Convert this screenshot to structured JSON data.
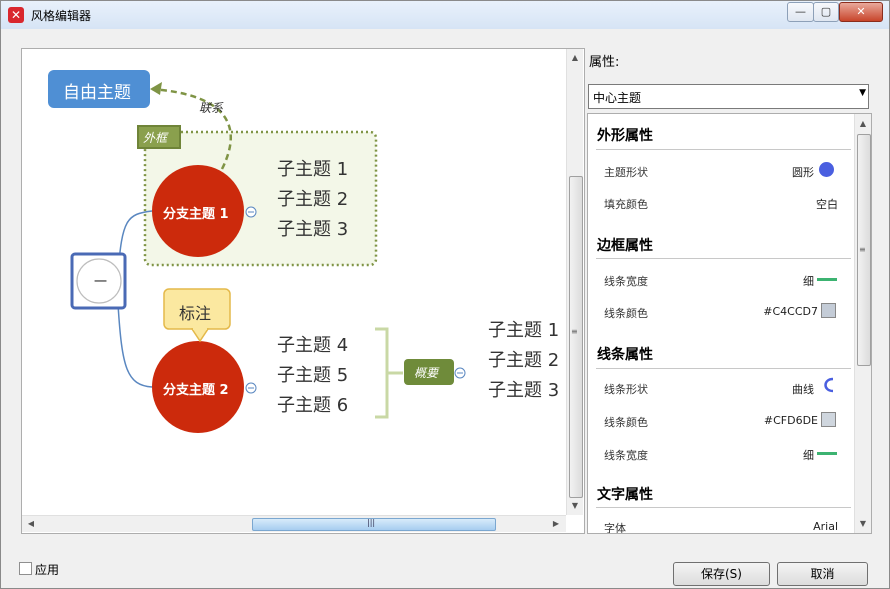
{
  "window": {
    "title": "风格编辑器",
    "minimize_label": "—",
    "maximize_label": "▢",
    "close_label": "✕"
  },
  "canvas": {
    "free_topic": "自由主题",
    "relation_label": "联系",
    "boundary_label": "外框",
    "central_label": "一",
    "branch1": "分支主题 1",
    "branch2": "分支主题 2",
    "callout": "标注",
    "summary": "概要",
    "branch1_subtopics": [
      "子主题 1",
      "子主题 2",
      "子主题 3"
    ],
    "branch2_subtopics": [
      "子主题 4",
      "子主题 5",
      "子主题 6"
    ],
    "summary_subtopics": [
      "子主题 1",
      "子主题 2",
      "子主题 3"
    ],
    "hscroll_grip": "|||",
    "vscroll_grip": "≡"
  },
  "panel": {
    "title": "属性:",
    "selector_value": "中心主题",
    "sections": {
      "shape": {
        "title": "外形属性",
        "topic_shape_label": "主题形状",
        "topic_shape_value": "圆形",
        "topic_shape_color": "#4a5fe0",
        "fill_color_label": "填充颜色",
        "fill_color_value": "空白"
      },
      "border": {
        "title": "边框属性",
        "line_width_label": "线条宽度",
        "line_width_value": "细",
        "line_color_label": "线条颜色",
        "line_color_value": "#C4CCD7"
      },
      "line": {
        "title": "线条属性",
        "line_shape_label": "线条形状",
        "line_shape_value": "曲线",
        "line_color_label": "线条颜色",
        "line_color_value": "#CFD6DE",
        "line_width_label": "线条宽度",
        "line_width_value": "细"
      },
      "text": {
        "title": "文字属性",
        "font_label": "字体",
        "font_value": "Arial"
      }
    }
  },
  "footer": {
    "apply_label": "应用",
    "save_label": "保存(S)",
    "cancel_label": "取消"
  },
  "colors": {
    "branch_red": "#cc2a0c",
    "free_topic_blue": "#4f8fd4",
    "boundary_green": "#7f9445",
    "summary_green": "#6f8b3a",
    "callout_yellow": "#fbe8a0",
    "accent_green": "#3cb371"
  }
}
